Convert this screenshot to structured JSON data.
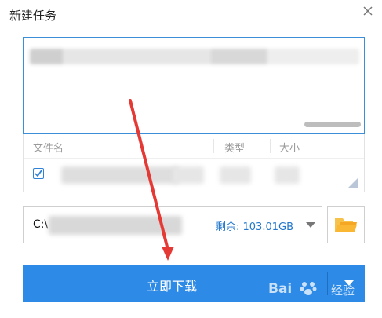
{
  "dialog": {
    "title": "新建任务",
    "close_icon": "close-icon"
  },
  "url_input": {
    "value_redacted": true
  },
  "file_list": {
    "columns": [
      "文件名",
      "类型",
      "大小"
    ],
    "rows": [
      {
        "checked": true,
        "name_redacted": true
      }
    ]
  },
  "save_path": {
    "prefix": "C:\\",
    "free_space": "剩余: 103.01GB",
    "dropdown_icon": "chevron-down-icon",
    "folder_icon": "folder-icon"
  },
  "download_button": {
    "label": "立即下载",
    "more_icon": "chevron-down-icon"
  },
  "watermark": {
    "brand": "Bai",
    "service": "经验"
  },
  "colors": {
    "accent": "#2d8ae6",
    "annotation_arrow": "#e53935",
    "free_space_text": "#2277cc"
  }
}
